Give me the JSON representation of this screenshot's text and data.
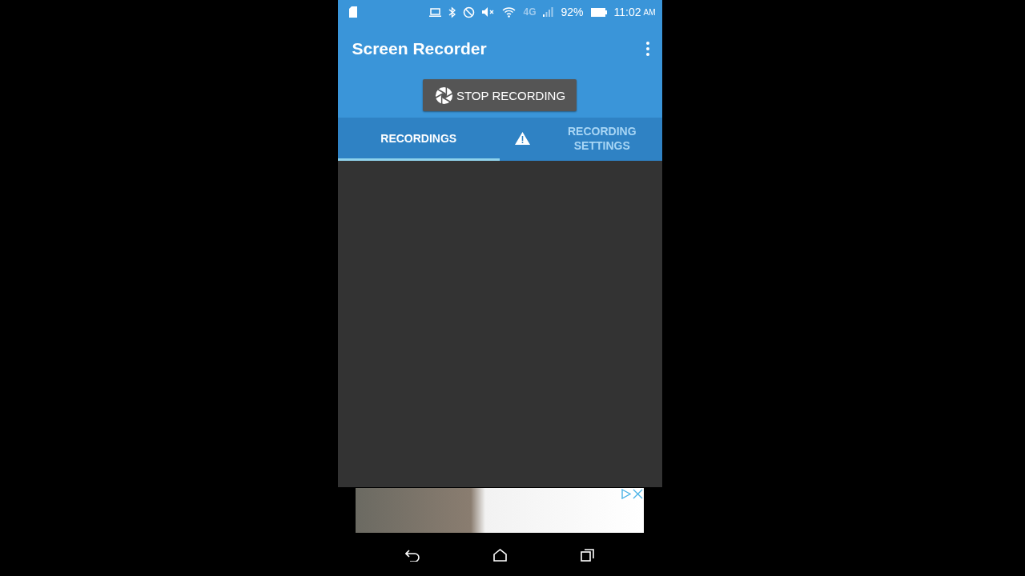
{
  "status_bar": {
    "network": "4G",
    "battery": "92%",
    "time": "11:02",
    "period": "AM"
  },
  "app_bar": {
    "title": "Screen Recorder"
  },
  "record_button": {
    "label": "STOP RECORDING"
  },
  "tabs": [
    {
      "label": "RECORDINGS",
      "selected": true,
      "alert": false
    },
    {
      "label": "RECORDING SETTINGS",
      "selected": false,
      "alert": true
    }
  ]
}
